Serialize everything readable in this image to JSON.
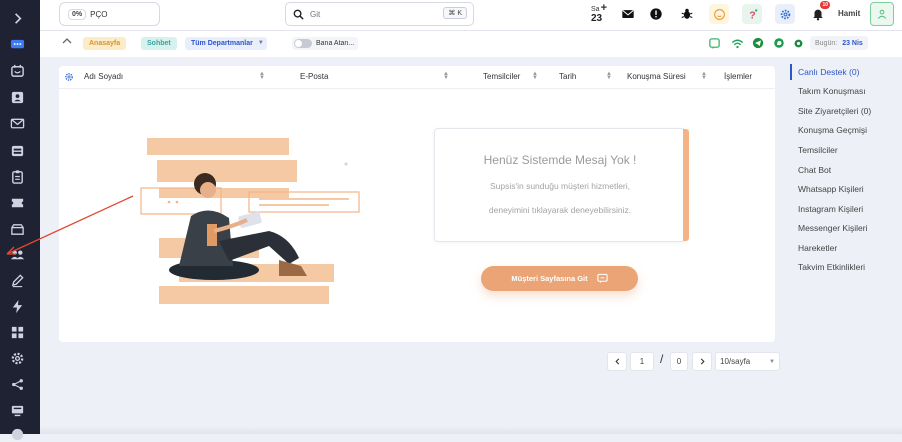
{
  "topbar": {
    "percent_badge": "0%",
    "percent_label": "PÇO",
    "search_placeholder": "Git",
    "search_shortcut": "⌘ K",
    "clock_label": "Sa",
    "clock_value": "23",
    "notification_count": "10",
    "user_name": "Hamit"
  },
  "filterbar": {
    "home_label": "Anasayfa",
    "chat_label": "Sohbet",
    "department_label": "Tüm Departmanlar",
    "toggle_label": "Bana Atan...",
    "today_label": "Bugün:",
    "today_value": "23 Nis"
  },
  "table": {
    "columns": [
      "Adı Soyadı",
      "E-Posta",
      "Temsilciler",
      "Tarih",
      "Konuşma Süresi",
      "İşlemler"
    ]
  },
  "empty_state": {
    "title": "Henüz Sistemde Mesaj Yok !",
    "line1": "Supsis'in sunduğu müşteri hizmetleri,",
    "line2": "deneyimini tıklayarak deneyebilirsiniz.",
    "cta_label": "Müşteri Sayfasına Git"
  },
  "pagination": {
    "current_page": "1",
    "total_pages": "0",
    "page_size": "10/sayfa"
  },
  "right_menu": {
    "items": [
      "Canlı Destek (0)",
      "Takım Konuşması",
      "Site Ziyaretçileri (0)",
      "Konuşma Geçmişi",
      "Temsilciler",
      "Chat Bot",
      "Whatsapp Kişileri",
      "Instagram Kişileri",
      "Messenger Kişileri",
      "Hareketler",
      "Takvim Etkinlikleri"
    ],
    "active_index": 0
  },
  "colors": {
    "rail": "#1e2233",
    "accent_blue": "#2d56c7",
    "accent_orange": "#eba476",
    "annotation_arrow": "#e0492f"
  },
  "rail_icons": [
    "expand-chevron-icon",
    "chat-bubbles-icon",
    "inbox-icon",
    "contact-card-icon",
    "mail-icon",
    "archive-icon",
    "clipboard-icon",
    "ticket-icon",
    "folder-icon",
    "users-icon",
    "edit-icon",
    "flash-icon",
    "grid-icon",
    "settings-icon",
    "share-icon",
    "monitor-icon",
    "chart-icon"
  ]
}
